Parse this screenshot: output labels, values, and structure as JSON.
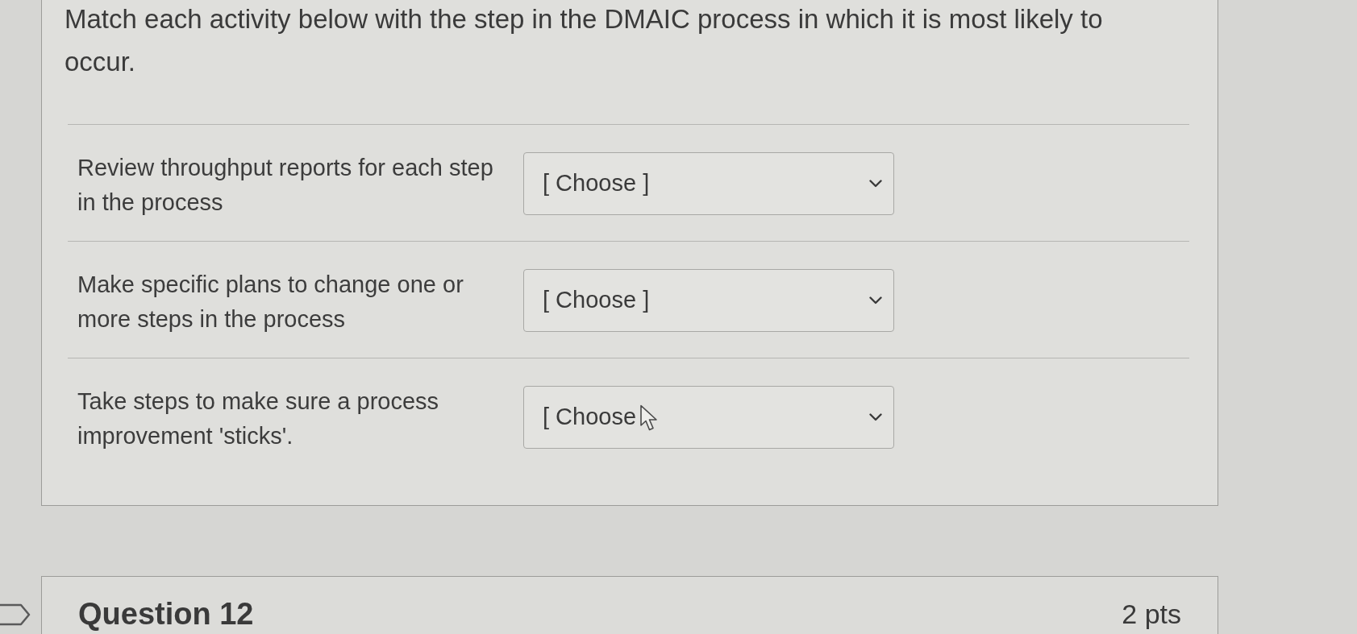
{
  "question": {
    "text": "Match each activity below with the step in the DMAIC process in which it is most likely to occur."
  },
  "matches": [
    {
      "prompt": "Review throughput reports for each step in the process",
      "dropdown": {
        "value": "[ Choose ]"
      }
    },
    {
      "prompt": "Make specific plans to change one or more steps in the process",
      "dropdown": {
        "value": "[ Choose ]"
      }
    },
    {
      "prompt": "Take steps to make sure a process improvement 'sticks'.",
      "dropdown": {
        "value": "[ Choose"
      }
    }
  ],
  "next_question": {
    "title": "Question 12",
    "points": "2 pts"
  }
}
